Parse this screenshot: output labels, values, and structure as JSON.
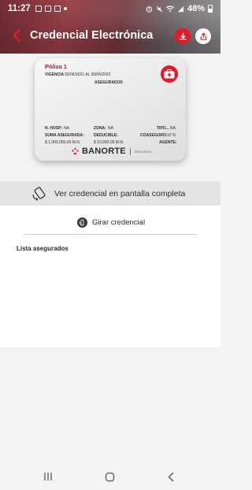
{
  "status_bar": {
    "time": "11:27",
    "battery": "48%"
  },
  "header": {
    "title": "Credencial Electrónica",
    "icons": [
      "back-arrow-icon",
      "download-icon",
      "share-icon"
    ],
    "colors": {
      "accent": "#e21b2c",
      "title": "#ffffff"
    }
  },
  "card": {
    "poliza": "Póliza 1",
    "vigencia_label": "VIGENCIA",
    "vigencia_value": "30/06/2021 AL 30/06/2022",
    "asegurados_label": "ASEGURADOS",
    "n_hosp_label": "N. HOSP:",
    "n_hosp_value": "NA",
    "zona_label": "ZONA:",
    "zona_value": "NA",
    "tipo_label": "TIPO...",
    "tipo_value": "NA",
    "suma_label": "SUMA ASEGURADA:",
    "suma_value": "$ 1,000,000.00 M.N.",
    "deducible_label": "DEDUCIBLE:",
    "deducible_value": "$ 10,000.00 M.N.",
    "coaseguro_label": "COASEGURO:",
    "coaseguro_value": "10 %",
    "agente_label": "AGENTE:",
    "brand": "BANORTE",
    "brand_sub": "SEGUROS"
  },
  "fullscreen": {
    "label": "Ver credencial en pantalla completa"
  },
  "rotate": {
    "label": "Girar credencial"
  },
  "lista": {
    "title": "Lista asegurados"
  }
}
